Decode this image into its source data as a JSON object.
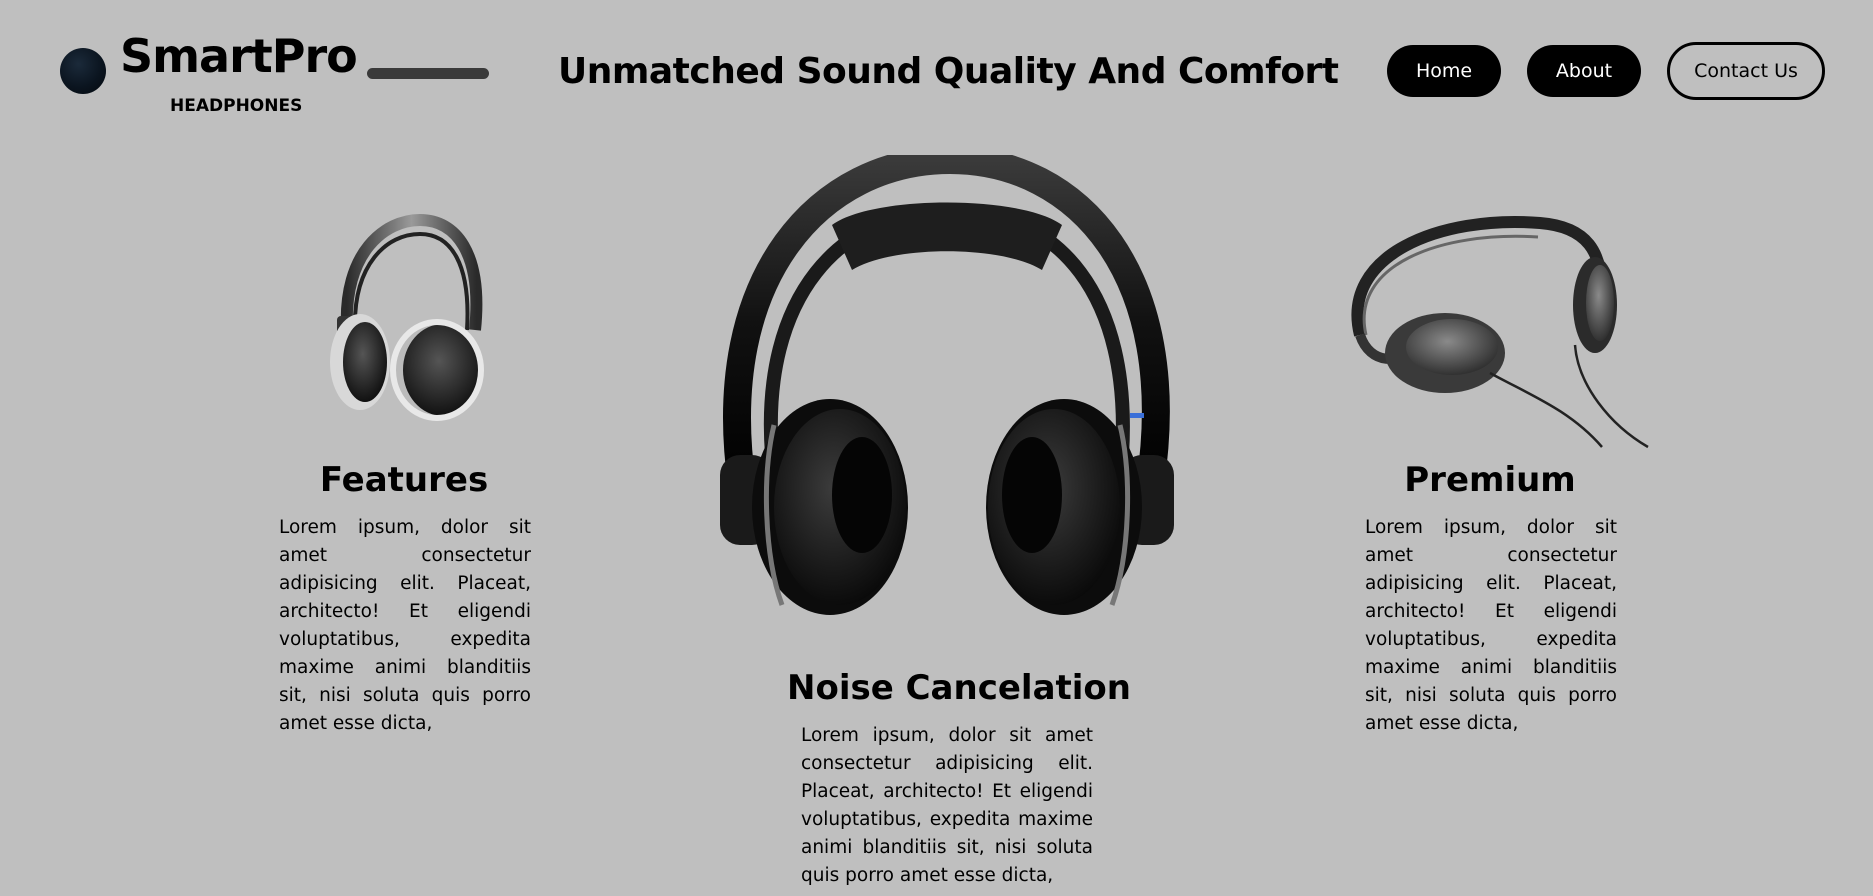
{
  "header": {
    "brand_name": "SmartPro",
    "brand_sub": "HEADPHONES",
    "tagline": "Unmatched Sound Quality And Comfort",
    "nav": {
      "home": "Home",
      "about": "About",
      "contact": "Contact Us"
    }
  },
  "products": [
    {
      "title": "Features",
      "text": "Lorem ipsum, dolor sit amet consectetur adipisicing elit. Placeat, architecto! Et eligendi voluptatibus, expedita maxime animi blanditiis sit, nisi soluta quis porro amet esse dicta,",
      "image_icon": "headphones-silver-icon"
    },
    {
      "title": "Noise Cancelation",
      "text": "Lorem ipsum, dolor sit amet consectetur adipisicing elit. Placeat, architecto! Et eligendi voluptatibus, expedita maxime animi blanditiis sit, nisi soluta quis porro amet esse dicta,",
      "image_icon": "headphones-black-icon"
    },
    {
      "title": "Premium",
      "text": "Lorem ipsum, dolor sit amet consectetur adipisicing elit. Placeat, architecto! Et eligendi voluptatibus, expedita maxime animi blanditiis sit, nisi soluta quis porro amet esse dicta,",
      "image_icon": "headphones-wired-icon"
    }
  ],
  "colors": {
    "background": "#bfbfbf",
    "button_dark": "#000000",
    "button_text_light": "#ffffff",
    "logo_dot": "#0b1520"
  }
}
